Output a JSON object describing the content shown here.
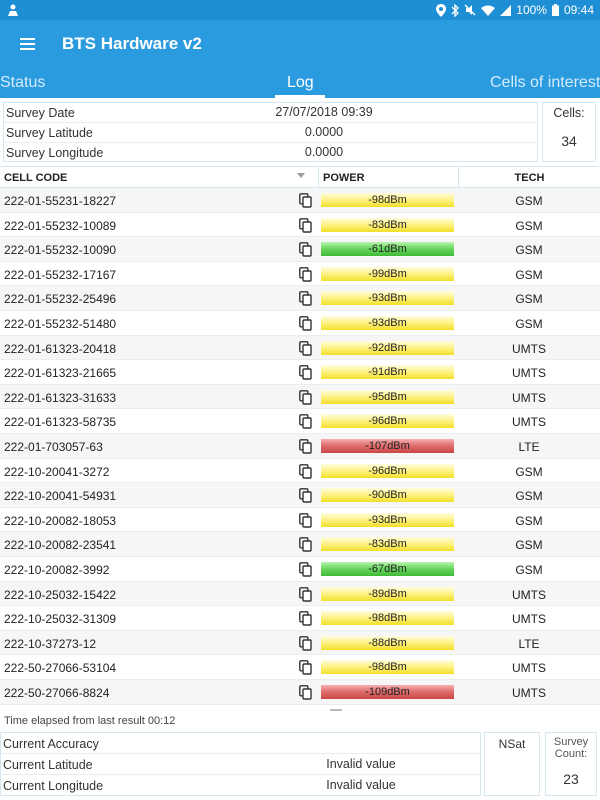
{
  "status_bar": {
    "battery": "100%",
    "time": "09:44",
    "icons": [
      "location-icon",
      "bluetooth-icon",
      "mute-icon",
      "wifi-icon",
      "signal-icon",
      "battery-icon"
    ]
  },
  "app_bar": {
    "title": "BTS Hardware v2",
    "menu_icon": "hamburger-menu-icon"
  },
  "tabs": [
    {
      "label": "Status",
      "active": false
    },
    {
      "label": "Log",
      "active": true
    },
    {
      "label": "Cells of interest",
      "active": false
    }
  ],
  "survey": {
    "date_label": "Survey Date",
    "date_value": "27/07/2018 09:39",
    "lat_label": "Survey Latitude",
    "lat_value": "0.0000",
    "lon_label": "Survey Longitude",
    "lon_value": "0.0000",
    "cells_label": "Cells:",
    "cells_value": "34"
  },
  "table": {
    "headers": {
      "code": "CELL CODE",
      "power": "POWER",
      "tech": "TECH"
    },
    "rows": [
      {
        "code": "222-01-55231-18227",
        "power": "-98dBm",
        "level": "yellow",
        "tech": "GSM"
      },
      {
        "code": "222-01-55232-10089",
        "power": "-83dBm",
        "level": "yellow",
        "tech": "GSM"
      },
      {
        "code": "222-01-55232-10090",
        "power": "-61dBm",
        "level": "green",
        "tech": "GSM"
      },
      {
        "code": "222-01-55232-17167",
        "power": "-99dBm",
        "level": "yellow",
        "tech": "GSM"
      },
      {
        "code": "222-01-55232-25496",
        "power": "-93dBm",
        "level": "yellow",
        "tech": "GSM"
      },
      {
        "code": "222-01-55232-51480",
        "power": "-93dBm",
        "level": "yellow",
        "tech": "GSM"
      },
      {
        "code": "222-01-61323-20418",
        "power": "-92dBm",
        "level": "yellow",
        "tech": "UMTS"
      },
      {
        "code": "222-01-61323-21665",
        "power": "-91dBm",
        "level": "yellow",
        "tech": "UMTS"
      },
      {
        "code": "222-01-61323-31633",
        "power": "-95dBm",
        "level": "yellow",
        "tech": "UMTS"
      },
      {
        "code": "222-01-61323-58735",
        "power": "-96dBm",
        "level": "yellow",
        "tech": "UMTS"
      },
      {
        "code": "222-01-703057-63",
        "power": "-107dBm",
        "level": "red",
        "tech": "LTE"
      },
      {
        "code": "222-10-20041-3272",
        "power": "-96dBm",
        "level": "yellow",
        "tech": "GSM"
      },
      {
        "code": "222-10-20041-54931",
        "power": "-90dBm",
        "level": "yellow",
        "tech": "GSM"
      },
      {
        "code": "222-10-20082-18053",
        "power": "-93dBm",
        "level": "yellow",
        "tech": "GSM"
      },
      {
        "code": "222-10-20082-23541",
        "power": "-83dBm",
        "level": "yellow",
        "tech": "GSM"
      },
      {
        "code": "222-10-20082-3992",
        "power": "-67dBm",
        "level": "green",
        "tech": "GSM"
      },
      {
        "code": "222-10-25032-15422",
        "power": "-89dBm",
        "level": "yellow",
        "tech": "UMTS"
      },
      {
        "code": "222-10-25032-31309",
        "power": "-98dBm",
        "level": "yellow",
        "tech": "UMTS"
      },
      {
        "code": "222-10-37273-12",
        "power": "-88dBm",
        "level": "yellow",
        "tech": "LTE"
      },
      {
        "code": "222-50-27066-53104",
        "power": "-98dBm",
        "level": "yellow",
        "tech": "UMTS"
      },
      {
        "code": "222-50-27066-8824",
        "power": "-109dBm",
        "level": "red",
        "tech": "UMTS"
      }
    ],
    "level_colors": {
      "yellow": "#fff38a",
      "green": "#6cd861",
      "red": "#e07070"
    }
  },
  "elapsed_text": "Time elapsed from last result 00:12",
  "gps": {
    "accuracy_label": "Current Accuracy",
    "accuracy_value": "",
    "lat_label": "Current Latitude",
    "lat_value": "Invalid value",
    "lon_label": "Current Longitude",
    "lon_value": "Invalid value",
    "nsat_label": "NSat",
    "count_label": "Survey Count:",
    "count_value": "23"
  },
  "colors": {
    "accent": "#2b9be0",
    "status_bar": "#1e8fd4"
  }
}
